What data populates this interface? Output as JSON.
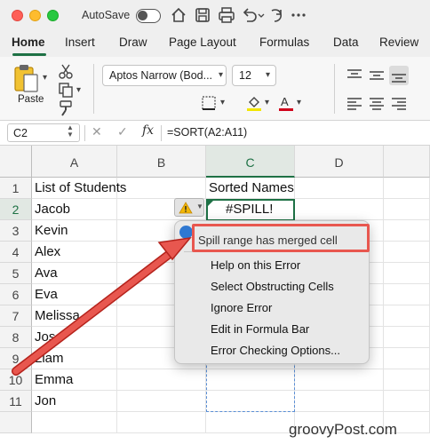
{
  "titlebar": {
    "autosave_label": "AutoSave",
    "autosave_on": false,
    "icons": [
      "home-icon",
      "save-icon",
      "print-icon",
      "undo-icon",
      "redo-icon",
      "more-icon"
    ]
  },
  "tabs": [
    {
      "label": "Home",
      "active": true
    },
    {
      "label": "Insert"
    },
    {
      "label": "Draw"
    },
    {
      "label": "Page Layout"
    },
    {
      "label": "Formulas"
    },
    {
      "label": "Data"
    },
    {
      "label": "Review"
    }
  ],
  "ribbon": {
    "paste_label": "Paste",
    "font_name": "Aptos Narrow (Bod...",
    "font_size": "12",
    "font_color": "#d0021b",
    "highlight_color": "#f2e600"
  },
  "formula_bar": {
    "cell_ref": "C2",
    "fx_label": "fx",
    "formula": "=SORT(A2:A11)"
  },
  "columns": [
    "A",
    "B",
    "C",
    "D"
  ],
  "rows": [
    "1",
    "2",
    "3",
    "4",
    "5",
    "6",
    "7",
    "8",
    "9",
    "10",
    "11"
  ],
  "cells": {
    "A": [
      "List of Students",
      "Jacob",
      "Kevin",
      "Alex",
      "Ava",
      "Eva",
      "Melissa",
      "Jose",
      "Liam",
      "Emma",
      "Jon"
    ],
    "C1": "Sorted Names",
    "C2": "#SPILL!"
  },
  "error_menu": {
    "header": "Spill range has merged cell",
    "items": [
      "Help on this Error",
      "Select Obstructing Cells",
      "Ignore Error",
      "Edit in Formula Bar",
      "Error Checking Options..."
    ]
  },
  "colors": {
    "accent": "#1e7145",
    "callout": "#e8574f"
  },
  "watermark": "groovyPost.com"
}
